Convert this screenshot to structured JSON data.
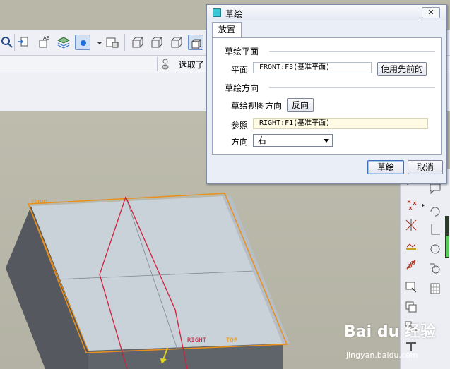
{
  "dialog": {
    "title": "草绘",
    "close_label": "✕",
    "tab": "放置",
    "sketch_plane_group": "草绘平面",
    "plane_label": "平面",
    "plane_value": "FRONT:F3(基准平面)",
    "use_previous_button": "使用先前的",
    "sketch_orientation_group": "草绘方向",
    "view_direction_label": "草绘视图方向",
    "flip_button": "反向",
    "reference_label": "参照",
    "reference_value": "RIGHT:F1(基准平面)",
    "orientation_label": "方向",
    "orientation_value": "右",
    "sketch_button": "草绘",
    "cancel_button": "取消"
  },
  "status": {
    "selection_text": "选取了"
  },
  "viewport": {
    "datum_labels": {
      "front": "FRONT",
      "right": "RIGHT",
      "top": "TOP"
    }
  },
  "watermark": {
    "brand": "Bai du 经验",
    "url": "jingyan.baidu.com"
  },
  "colors": {
    "selected_edge": "#e8901c",
    "sketch_lines": "#d2203c",
    "dialog_bg": "#eaeef6",
    "reference_field_bg": "#fffbe4"
  }
}
